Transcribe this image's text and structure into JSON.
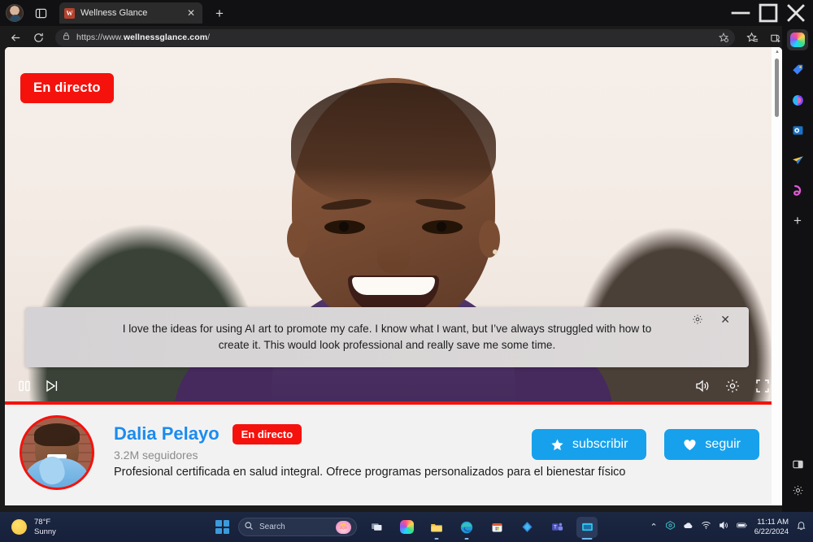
{
  "browser": {
    "tab": {
      "title": "Wellness Glance",
      "favicon_letter": "W",
      "close_label": "✕"
    },
    "new_tab_label": "+",
    "window_controls": {
      "minimize": "─",
      "maximize": "☐",
      "close": "✕"
    },
    "address": {
      "url_prefix": "https://www.",
      "url_domain": "wellnessglance.com",
      "url_suffix": "/"
    },
    "icons": {
      "profile": "user-avatar-icon",
      "tab_actions": "tab-actions-icon",
      "back": "back-arrow-icon",
      "refresh": "refresh-icon",
      "lock": "lock-icon",
      "favorite": "star-add-icon",
      "favorites_bar": "favorites-icon",
      "collections": "collections-icon",
      "settings_more": "more-options-icon",
      "copilot": "copilot-icon"
    }
  },
  "sidebar": {
    "items": [
      {
        "name": "copilot",
        "glyph": ""
      },
      {
        "name": "shopping-tag",
        "glyph": "🏷"
      },
      {
        "name": "microsoft-365",
        "glyph": "◐"
      },
      {
        "name": "outlook",
        "glyph": "✉"
      },
      {
        "name": "telegram-send",
        "glyph": "➤"
      },
      {
        "name": "games",
        "glyph": "🎮"
      },
      {
        "name": "add-tool",
        "glyph": "+"
      }
    ],
    "bottom": [
      {
        "name": "split-screen",
        "glyph": "◧"
      },
      {
        "name": "sidebar-settings",
        "glyph": "⚙"
      }
    ]
  },
  "video": {
    "live_badge": "En directo",
    "caption_text": "I love the ideas for using AI art to promote my cafe. I know what I want, but I’ve always struggled with how to create it. This would look professional and really save me some time.",
    "caption_controls": {
      "settings": "caption-settings-icon",
      "close": "✕"
    },
    "controls": {
      "pause": "pause-icon",
      "next": "next-track-icon",
      "volume": "volume-icon",
      "settings": "player-settings-icon",
      "fullscreen": "fullscreen-icon"
    },
    "progress_color": "#f5120d"
  },
  "creator": {
    "name": "Dalia Pelayo",
    "live_badge": "En directo",
    "followers": "3.2M seguidores",
    "bio": "Profesional certificada en salud integral. Ofrece programas personalizados para el bienestar físico",
    "avatar": "creator-avatar",
    "name_color": "#1a8cf0",
    "buttons": [
      {
        "label": "subscribir",
        "icon": "star-icon",
        "name": "subscribe-button"
      },
      {
        "label": "seguir",
        "icon": "heart-icon",
        "name": "follow-button"
      }
    ],
    "button_color": "#17a1ed"
  },
  "taskbar": {
    "weather": {
      "temperature": "78°F",
      "condition": "Sunny",
      "icon": "sun-icon"
    },
    "start": "windows-start-icon",
    "search": {
      "placeholder": "Search",
      "icon": "search-icon",
      "badge": "lotus-icon",
      "badge_glyph": "🪷"
    },
    "apps": [
      {
        "name": "task-view",
        "glyph": "⧉"
      },
      {
        "name": "copilot",
        "glyph": ""
      },
      {
        "name": "file-explorer",
        "glyph": "📁"
      },
      {
        "name": "microsoft-edge",
        "glyph": ""
      },
      {
        "name": "microsoft-store",
        "glyph": "🏪"
      },
      {
        "name": "microsoft-defender",
        "glyph": "❖"
      },
      {
        "name": "microsoft-teams",
        "glyph": "T"
      },
      {
        "name": "active-window",
        "glyph": "▤"
      }
    ],
    "tray": {
      "overflow": "⌃",
      "icons": [
        "onedrive-sync-icon",
        "cloud-icon",
        "wifi-icon",
        "speaker-icon",
        "battery-icon"
      ],
      "time": "11:11 AM",
      "date": "6/22/2024",
      "notifications": "bell-icon"
    }
  }
}
